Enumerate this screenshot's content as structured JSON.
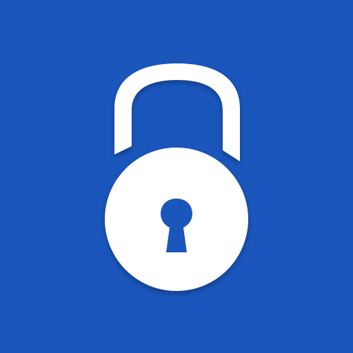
{
  "app_icon": {
    "icon": "padlock-icon",
    "background_color": "#1A56BC",
    "foreground_color": "#FFFFFF",
    "keyhole_color": "#1A56BC"
  }
}
